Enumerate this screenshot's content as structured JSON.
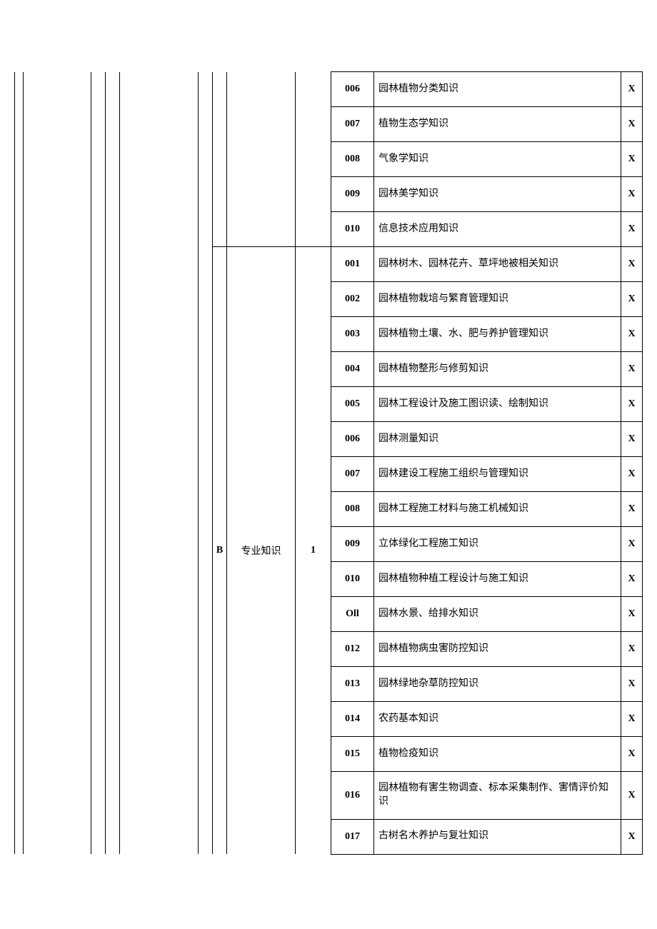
{
  "section_b_letter": "B",
  "section_b_title": "专业知识",
  "section_b_num": "1",
  "group_a_rows": [
    {
      "code": "006",
      "label": "园林植物分类知识",
      "mark": "X"
    },
    {
      "code": "007",
      "label": "植物生态学知识",
      "mark": "X"
    },
    {
      "code": "008",
      "label": "气象学知识",
      "mark": "X"
    },
    {
      "code": "009",
      "label": "园林美学知识",
      "mark": "X"
    },
    {
      "code": "010",
      "label": "信息技术应用知识",
      "mark": "X"
    }
  ],
  "group_b_rows": [
    {
      "code": "001",
      "label": "园林树木、园林花卉、草坪地被相关知识",
      "mark": "X"
    },
    {
      "code": "002",
      "label": "园林植物栽培与繁育管理知识",
      "mark": "X"
    },
    {
      "code": "003",
      "label": "园林植物土壤、水、肥与养护管理知识",
      "mark": "X"
    },
    {
      "code": "004",
      "label": "园林植物整形与修剪知识",
      "mark": "X"
    },
    {
      "code": "005",
      "label": "园林工程设计及施工图识读、绘制知识",
      "mark": "X"
    },
    {
      "code": "006",
      "label": "园林测量知识",
      "mark": "X"
    },
    {
      "code": "007",
      "label": "园林建设工程施工组织与管理知识",
      "mark": "X"
    },
    {
      "code": "008",
      "label": "园林工程施工材料与施工机械知识",
      "mark": "X"
    },
    {
      "code": "009",
      "label": "立体绿化工程施工知识",
      "mark": "X"
    },
    {
      "code": "010",
      "label": "园林植物种植工程设计与施工知识",
      "mark": "X"
    },
    {
      "code": "Oll",
      "label": "园林水景、给排水知识",
      "mark": "X"
    },
    {
      "code": "012",
      "label": "园林植物病虫害防控知识",
      "mark": "X"
    },
    {
      "code": "013",
      "label": "园林绿地杂草防控知识",
      "mark": "X"
    },
    {
      "code": "014",
      "label": "农药基本知识",
      "mark": "X"
    },
    {
      "code": "015",
      "label": "植物检疫知识",
      "mark": "X"
    },
    {
      "code": "016",
      "label": "园林植物有害生物调查、标本采集制作、害情评价知识",
      "mark": "X"
    },
    {
      "code": "017",
      "label": "古树名木养护与复壮知识",
      "mark": "X"
    }
  ]
}
